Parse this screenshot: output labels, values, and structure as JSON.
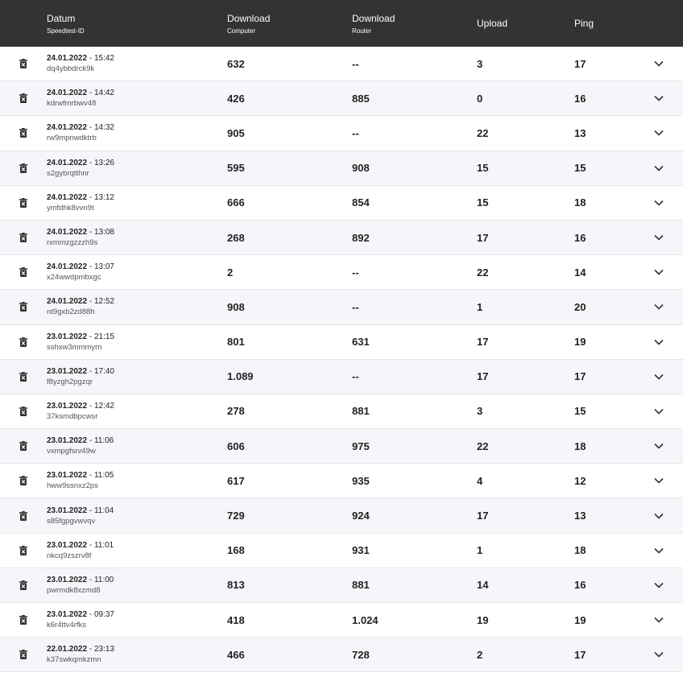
{
  "header": {
    "date_label": "Datum",
    "date_sub": "Speedtest-ID",
    "dl_computer_label": "Download",
    "dl_computer_sub": "Computer",
    "dl_router_label": "Download",
    "dl_router_sub": "Router",
    "upload_label": "Upload",
    "ping_label": "Ping"
  },
  "icons": {
    "delete": "trash-icon",
    "expand": "chevron-down-icon"
  },
  "colors": {
    "header_bg": "#333333",
    "row_alt_bg": "#f4f6f9"
  },
  "rows": [
    {
      "date": "24.01.2022",
      "sep": " - ",
      "time": "15:42",
      "id": "dq4ybbdrck9k",
      "dl_computer": "632",
      "dl_router": "--",
      "upload": "3",
      "ping": "17"
    },
    {
      "date": "24.01.2022",
      "sep": " - ",
      "time": "14:42",
      "id": "kdrwfmrbwv48",
      "dl_computer": "426",
      "dl_router": "885",
      "upload": "0",
      "ping": "16"
    },
    {
      "date": "24.01.2022",
      "sep": " - ",
      "time": "14:32",
      "id": "rw9mpnwdktrb",
      "dl_computer": "905",
      "dl_router": "--",
      "upload": "22",
      "ping": "13"
    },
    {
      "date": "24.01.2022",
      "sep": " - ",
      "time": "13:26",
      "id": "s2gybrqtthnr",
      "dl_computer": "595",
      "dl_router": "908",
      "upload": "15",
      "ping": "15"
    },
    {
      "date": "24.01.2022",
      "sep": " - ",
      "time": "13:12",
      "id": "ymfdhk8vvn9t",
      "dl_computer": "666",
      "dl_router": "854",
      "upload": "15",
      "ping": "18"
    },
    {
      "date": "24.01.2022",
      "sep": " - ",
      "time": "13:08",
      "id": "rxmmzgzzzh9s",
      "dl_computer": "268",
      "dl_router": "892",
      "upload": "17",
      "ping": "16"
    },
    {
      "date": "24.01.2022",
      "sep": " - ",
      "time": "13:07",
      "id": "x24wwdpmbxgc",
      "dl_computer": "2",
      "dl_router": "--",
      "upload": "22",
      "ping": "14"
    },
    {
      "date": "24.01.2022",
      "sep": " - ",
      "time": "12:52",
      "id": "nt9gxb2zd88h",
      "dl_computer": "908",
      "dl_router": "--",
      "upload": "1",
      "ping": "20"
    },
    {
      "date": "23.01.2022",
      "sep": " - ",
      "time": "21:15",
      "id": "sshxw3mmmyrn",
      "dl_computer": "801",
      "dl_router": "631",
      "upload": "17",
      "ping": "19"
    },
    {
      "date": "23.01.2022",
      "sep": " - ",
      "time": "17:40",
      "id": "f8yzgh2pgzqr",
      "dl_computer": "1.089",
      "dl_router": "--",
      "upload": "17",
      "ping": "17"
    },
    {
      "date": "23.01.2022",
      "sep": " - ",
      "time": "12:42",
      "id": "37ksmdbpcwsr",
      "dl_computer": "278",
      "dl_router": "881",
      "upload": "3",
      "ping": "15"
    },
    {
      "date": "23.01.2022",
      "sep": " - ",
      "time": "11:06",
      "id": "vxmpgfsrv49w",
      "dl_computer": "606",
      "dl_router": "975",
      "upload": "22",
      "ping": "18"
    },
    {
      "date": "23.01.2022",
      "sep": " - ",
      "time": "11:05",
      "id": "hww9ssnxz2ps",
      "dl_computer": "617",
      "dl_router": "935",
      "upload": "4",
      "ping": "12"
    },
    {
      "date": "23.01.2022",
      "sep": " - ",
      "time": "11:04",
      "id": "s85fgpgvwvqv",
      "dl_computer": "729",
      "dl_router": "924",
      "upload": "17",
      "ping": "13"
    },
    {
      "date": "23.01.2022",
      "sep": " - ",
      "time": "11:01",
      "id": "nkcq9zszrv8f",
      "dl_computer": "168",
      "dl_router": "931",
      "upload": "1",
      "ping": "18"
    },
    {
      "date": "23.01.2022",
      "sep": " - ",
      "time": "11:00",
      "id": "pwrmdk8xzmd8",
      "dl_computer": "813",
      "dl_router": "881",
      "upload": "14",
      "ping": "16"
    },
    {
      "date": "23.01.2022",
      "sep": " - ",
      "time": "09:37",
      "id": "k6r4ttv4rfks",
      "dl_computer": "418",
      "dl_router": "1.024",
      "upload": "19",
      "ping": "19"
    },
    {
      "date": "22.01.2022",
      "sep": " - ",
      "time": "23:13",
      "id": "k37swkqmkzmn",
      "dl_computer": "466",
      "dl_router": "728",
      "upload": "2",
      "ping": "17"
    }
  ]
}
